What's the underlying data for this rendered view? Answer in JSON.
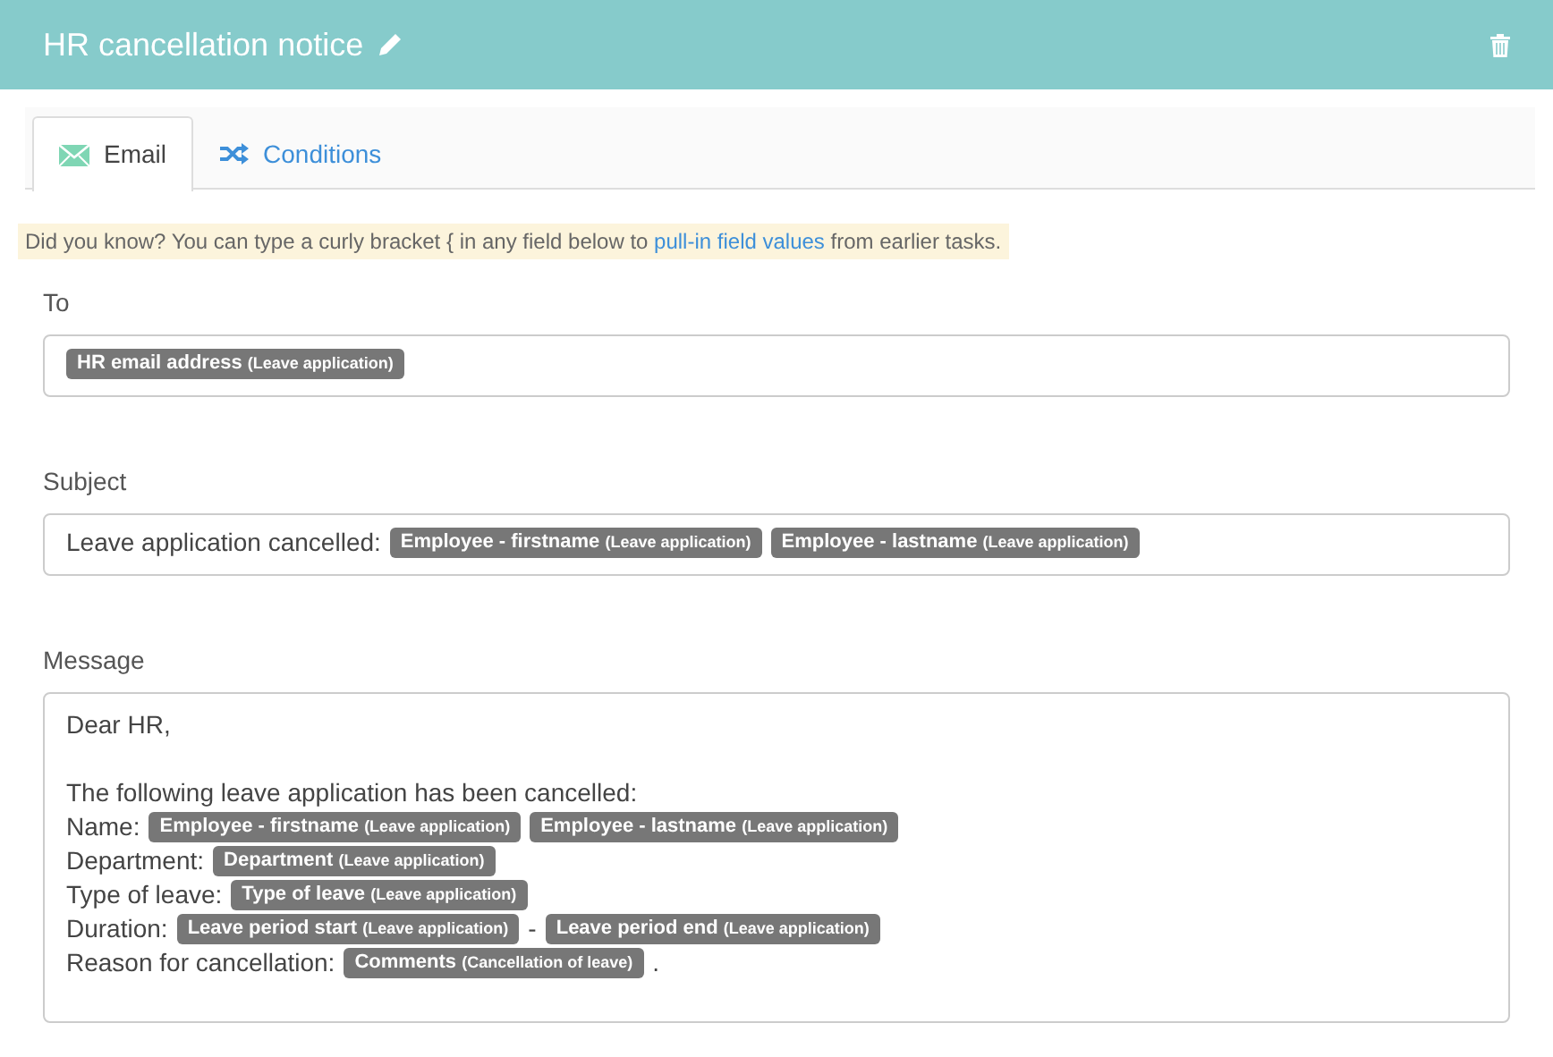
{
  "header": {
    "title": "HR cancellation notice"
  },
  "tabs": [
    {
      "label": "Email",
      "selected": true
    },
    {
      "label": "Conditions",
      "selected": false
    }
  ],
  "tip": {
    "before": "Did you know? You can type a curly bracket { in any field below to ",
    "link": "pull-in field values",
    "after": " from earlier tasks."
  },
  "fields": [
    {
      "label": "To",
      "kind": "line",
      "lines": [
        {
          "segments": [
            {
              "kind": "token",
              "field": "HR email address",
              "source": "(Leave application)"
            }
          ]
        }
      ]
    },
    {
      "label": "Subject",
      "kind": "line",
      "lines": [
        {
          "segments": [
            {
              "kind": "text",
              "text": "Leave application cancelled:"
            },
            {
              "kind": "token",
              "field": "Employee - firstname",
              "source": "(Leave application)"
            },
            {
              "kind": "token",
              "field": "Employee - lastname",
              "source": "(Leave application)"
            }
          ]
        }
      ]
    },
    {
      "label": "Message",
      "kind": "area",
      "paragraphs": [
        [
          {
            "segments": [
              {
                "kind": "text",
                "text": "Dear HR,"
              }
            ]
          }
        ],
        [
          {
            "segments": [
              {
                "kind": "text",
                "text": "The following leave application has been cancelled:"
              }
            ]
          },
          {
            "segments": [
              {
                "kind": "text",
                "text": "Name:"
              },
              {
                "kind": "token",
                "field": "Employee - firstname",
                "source": "(Leave application)"
              },
              {
                "kind": "token",
                "field": "Employee - lastname",
                "source": "(Leave application)"
              }
            ]
          },
          {
            "segments": [
              {
                "kind": "text",
                "text": "Department:"
              },
              {
                "kind": "token",
                "field": "Department",
                "source": "(Leave application)"
              }
            ]
          },
          {
            "segments": [
              {
                "kind": "text",
                "text": "Type of leave:"
              },
              {
                "kind": "token",
                "field": "Type of leave",
                "source": "(Leave application)"
              }
            ]
          },
          {
            "segments": [
              {
                "kind": "text",
                "text": "Duration:"
              },
              {
                "kind": "token",
                "field": "Leave period start",
                "source": "(Leave application)"
              },
              {
                "kind": "text",
                "text": "-"
              },
              {
                "kind": "token",
                "field": "Leave period end",
                "source": "(Leave application)"
              }
            ]
          },
          {
            "segments": [
              {
                "kind": "text",
                "text": "Reason for cancellation:"
              },
              {
                "kind": "token",
                "field": "Comments",
                "source": "(Cancellation of leave)"
              },
              {
                "kind": "text",
                "text": "."
              }
            ]
          }
        ]
      ]
    }
  ]
}
